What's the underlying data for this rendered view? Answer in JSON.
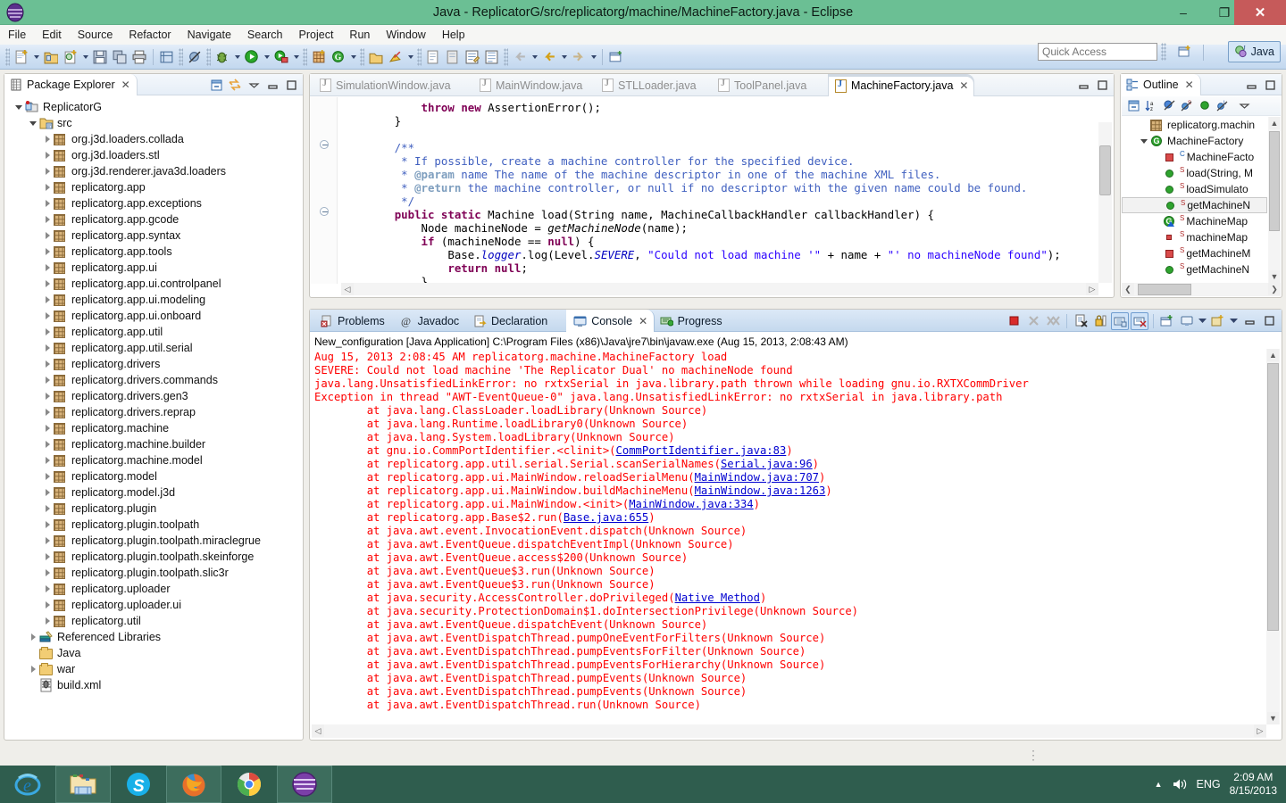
{
  "window": {
    "title": "Java - ReplicatorG/src/replicatorg/machine/MachineFactory.java - Eclipse",
    "minimize_label": "–",
    "maximize_label": "❐",
    "close_label": "✕"
  },
  "menubar": {
    "items": [
      "File",
      "Edit",
      "Source",
      "Refactor",
      "Navigate",
      "Search",
      "Project",
      "Run",
      "Window",
      "Help"
    ]
  },
  "toolbar": {
    "quick_access_placeholder": "Quick Access",
    "perspective_label": "Java",
    "icons": [
      "new-wizard-icon",
      "new-wizard-dropdown",
      "new-java-project-icon",
      "new-class-icon",
      "new-class-dropdown",
      "save-icon",
      "save-all-icon",
      "print-icon",
      "toggle-ruler-icon",
      "skip-breakpoints-icon",
      "debug-icon",
      "debug-dropdown",
      "run-icon",
      "run-dropdown",
      "run-external-tools-icon",
      "external-tools-dropdown",
      "new-java-package-icon",
      "new-annotation-icon",
      "new-annotation-dropdown",
      "open-type-icon",
      "search-icon",
      "search-dropdown",
      "next-annotation-icon",
      "previous-annotation-icon",
      "last-edit-icon",
      "toggle-mark-icon",
      "back-icon",
      "back-dropdown",
      "forward-icon",
      "forward-dropdown",
      "pin-editor-icon",
      "new-perspective-icon"
    ]
  },
  "package_explorer": {
    "title": "Package Explorer",
    "close_label": "✕",
    "tools": [
      "collapse-all-icon",
      "link-with-editor-icon",
      "view-menu-icon",
      "minimize-icon",
      "maximize-icon"
    ],
    "tree": [
      {
        "label": "ReplicatorG",
        "indent": 0,
        "arrow": "open",
        "icon": "java-project-icon"
      },
      {
        "label": "src",
        "indent": 1,
        "arrow": "open",
        "icon": "source-folder-icon"
      },
      {
        "label": "org.j3d.loaders.collada",
        "indent": 2,
        "arrow": "closed",
        "icon": "package-icon"
      },
      {
        "label": "org.j3d.loaders.stl",
        "indent": 2,
        "arrow": "closed",
        "icon": "package-icon"
      },
      {
        "label": "org.j3d.renderer.java3d.loaders",
        "indent": 2,
        "arrow": "closed",
        "icon": "package-icon"
      },
      {
        "label": "replicatorg.app",
        "indent": 2,
        "arrow": "closed",
        "icon": "package-icon"
      },
      {
        "label": "replicatorg.app.exceptions",
        "indent": 2,
        "arrow": "closed",
        "icon": "package-icon"
      },
      {
        "label": "replicatorg.app.gcode",
        "indent": 2,
        "arrow": "closed",
        "icon": "package-icon"
      },
      {
        "label": "replicatorg.app.syntax",
        "indent": 2,
        "arrow": "closed",
        "icon": "package-icon"
      },
      {
        "label": "replicatorg.app.tools",
        "indent": 2,
        "arrow": "closed",
        "icon": "package-icon"
      },
      {
        "label": "replicatorg.app.ui",
        "indent": 2,
        "arrow": "closed",
        "icon": "package-icon"
      },
      {
        "label": "replicatorg.app.ui.controlpanel",
        "indent": 2,
        "arrow": "closed",
        "icon": "package-icon"
      },
      {
        "label": "replicatorg.app.ui.modeling",
        "indent": 2,
        "arrow": "closed",
        "icon": "package-icon"
      },
      {
        "label": "replicatorg.app.ui.onboard",
        "indent": 2,
        "arrow": "closed",
        "icon": "package-icon"
      },
      {
        "label": "replicatorg.app.util",
        "indent": 2,
        "arrow": "closed",
        "icon": "package-icon"
      },
      {
        "label": "replicatorg.app.util.serial",
        "indent": 2,
        "arrow": "closed",
        "icon": "package-icon"
      },
      {
        "label": "replicatorg.drivers",
        "indent": 2,
        "arrow": "closed",
        "icon": "package-icon"
      },
      {
        "label": "replicatorg.drivers.commands",
        "indent": 2,
        "arrow": "closed",
        "icon": "package-icon"
      },
      {
        "label": "replicatorg.drivers.gen3",
        "indent": 2,
        "arrow": "closed",
        "icon": "package-icon"
      },
      {
        "label": "replicatorg.drivers.reprap",
        "indent": 2,
        "arrow": "closed",
        "icon": "package-icon"
      },
      {
        "label": "replicatorg.machine",
        "indent": 2,
        "arrow": "closed",
        "icon": "package-icon"
      },
      {
        "label": "replicatorg.machine.builder",
        "indent": 2,
        "arrow": "closed",
        "icon": "package-icon"
      },
      {
        "label": "replicatorg.machine.model",
        "indent": 2,
        "arrow": "closed",
        "icon": "package-icon"
      },
      {
        "label": "replicatorg.model",
        "indent": 2,
        "arrow": "closed",
        "icon": "package-icon"
      },
      {
        "label": "replicatorg.model.j3d",
        "indent": 2,
        "arrow": "closed",
        "icon": "package-icon"
      },
      {
        "label": "replicatorg.plugin",
        "indent": 2,
        "arrow": "closed",
        "icon": "package-icon"
      },
      {
        "label": "replicatorg.plugin.toolpath",
        "indent": 2,
        "arrow": "closed",
        "icon": "package-icon"
      },
      {
        "label": "replicatorg.plugin.toolpath.miraclegrue",
        "indent": 2,
        "arrow": "closed",
        "icon": "package-icon"
      },
      {
        "label": "replicatorg.plugin.toolpath.skeinforge",
        "indent": 2,
        "arrow": "closed",
        "icon": "package-icon"
      },
      {
        "label": "replicatorg.plugin.toolpath.slic3r",
        "indent": 2,
        "arrow": "closed",
        "icon": "package-icon"
      },
      {
        "label": "replicatorg.uploader",
        "indent": 2,
        "arrow": "closed",
        "icon": "package-icon"
      },
      {
        "label": "replicatorg.uploader.ui",
        "indent": 2,
        "arrow": "closed",
        "icon": "package-icon"
      },
      {
        "label": "replicatorg.util",
        "indent": 2,
        "arrow": "closed",
        "icon": "package-icon"
      },
      {
        "label": "Referenced Libraries",
        "indent": 1,
        "arrow": "closed",
        "icon": "library-icon"
      },
      {
        "label": "Java",
        "indent": 1,
        "arrow": "none",
        "icon": "folder-icon"
      },
      {
        "label": "war",
        "indent": 1,
        "arrow": "closed",
        "icon": "folder-icon"
      },
      {
        "label": "build.xml",
        "indent": 1,
        "arrow": "none",
        "icon": "ant-file-icon"
      }
    ]
  },
  "editor": {
    "tabs": [
      {
        "label": "SimulationWindow.java",
        "active": false,
        "closable": false
      },
      {
        "label": "MainWindow.java",
        "active": false,
        "closable": false
      },
      {
        "label": "STLLoader.java",
        "active": false,
        "closable": false
      },
      {
        "label": "ToolPanel.java",
        "active": false,
        "closable": false
      },
      {
        "label": "MachineFactory.java",
        "active": true,
        "closable": true
      }
    ],
    "close_label": "✕",
    "minimize_label": "❐",
    "maximize_label": "☐",
    "code_lines": [
      "            throw new AssertionError();",
      "        }",
      "",
      "        /**",
      "         * If possible, create a machine controller for the specified device.",
      "         * @param name The name of the machine descriptor in one of the machine XML files.",
      "         * @return the machine controller, or null if no descriptor with the given name could be found.",
      "         */",
      "        public static Machine load(String name, MachineCallbackHandler callbackHandler) {",
      "            Node machineNode = getMachineNode(name);",
      "            if (machineNode == null) {",
      "                Base.logger.log(Level.SEVERE, \"Could not load machine '\" + name + \"' no machineNode found\");",
      "                return null;",
      "            }"
    ]
  },
  "outline": {
    "title": "Outline",
    "close_label": "✕",
    "tools": [
      "collapse-all-icon",
      "sort-icon",
      "hide-fields-icon",
      "hide-static-icon",
      "hide-nonpublic-icon",
      "hide-local-types-icon",
      "view-menu-icon"
    ],
    "minimize_label": "❐",
    "maximize_label": "☐",
    "items": [
      {
        "label": "replicatorg.machin",
        "indent": 1,
        "arrow": "none",
        "icon": "package-icon",
        "modifier": "",
        "selected": false
      },
      {
        "label": "MachineFactory",
        "indent": 1,
        "arrow": "open",
        "icon": "class-icon",
        "modifier": "",
        "selected": false
      },
      {
        "label": "MachineFacto",
        "indent": 2,
        "arrow": "none",
        "icon": "field-private-icon",
        "modifier": "C",
        "selected": false
      },
      {
        "label": "load(String, M",
        "indent": 2,
        "arrow": "none",
        "icon": "method-public-icon",
        "modifier": "S",
        "selected": false
      },
      {
        "label": "loadSimulato",
        "indent": 2,
        "arrow": "none",
        "icon": "method-public-icon",
        "modifier": "S",
        "selected": false
      },
      {
        "label": "getMachineN",
        "indent": 2,
        "arrow": "none",
        "icon": "method-public-icon",
        "modifier": "S",
        "selected": true
      },
      {
        "label": "MachineMap",
        "indent": 2,
        "arrow": "none",
        "icon": "inner-class-icon",
        "modifier": "S",
        "selected": false
      },
      {
        "label": "machineMap",
        "indent": 2,
        "arrow": "none",
        "icon": "field-small-icon",
        "modifier": "S",
        "selected": false
      },
      {
        "label": "getMachineM",
        "indent": 2,
        "arrow": "none",
        "icon": "field-private-icon",
        "modifier": "S",
        "selected": false
      },
      {
        "label": "getMachineN",
        "indent": 2,
        "arrow": "none",
        "icon": "method-public-icon",
        "modifier": "S",
        "selected": false
      }
    ],
    "scroll_left": "❮",
    "scroll_right": "❯"
  },
  "console": {
    "tabs": [
      {
        "label": "Problems",
        "icon": "problems-icon",
        "active": false,
        "closable": false
      },
      {
        "label": "Javadoc",
        "icon": "javadoc-icon",
        "active": false,
        "closable": false
      },
      {
        "label": "Declaration",
        "icon": "declaration-icon",
        "active": false,
        "closable": false
      },
      {
        "label": "Console",
        "icon": "console-icon",
        "active": true,
        "closable": true
      },
      {
        "label": "Progress",
        "icon": "progress-icon",
        "active": false,
        "closable": false
      }
    ],
    "close_label": "✕",
    "tools": [
      "terminate-icon",
      "remove-launch-icon",
      "remove-all-terminated-icon",
      "clear-console-icon",
      "scroll-lock-icon",
      "pin-console-icon",
      "show-console-on-output-icon",
      "open-console-icon",
      "display-selected-console-icon",
      "display-console-dropdown",
      "new-console-view-icon",
      "new-console-dropdown",
      "minimize-icon",
      "maximize-icon"
    ],
    "header": "New_configuration [Java Application] C:\\Program Files (x86)\\Java\\jre7\\bin\\javaw.exe (Aug 15, 2013, 2:08:43 AM)",
    "lines": [
      {
        "text": "Aug 15, 2013 2:08:45 AM replicatorg.machine.MachineFactory load",
        "indent": 0,
        "links": []
      },
      {
        "text": "SEVERE: Could not load machine 'The Replicator Dual' no machineNode found",
        "indent": 0,
        "links": []
      },
      {
        "text": "java.lang.UnsatisfiedLinkError: no rxtxSerial in java.library.path thrown while loading gnu.io.RXTXCommDriver",
        "indent": 0,
        "links": []
      },
      {
        "text": "Exception in thread \"AWT-EventQueue-0\" java.lang.UnsatisfiedLinkError: no rxtxSerial in java.library.path",
        "indent": 0,
        "links": []
      },
      {
        "text": "        at java.lang.ClassLoader.loadLibrary(Unknown Source)",
        "indent": 1,
        "links": []
      },
      {
        "text": "        at java.lang.Runtime.loadLibrary0(Unknown Source)",
        "indent": 1,
        "links": []
      },
      {
        "text": "        at java.lang.System.loadLibrary(Unknown Source)",
        "indent": 1,
        "links": []
      },
      {
        "text": "        at gnu.io.CommPortIdentifier.<clinit>(",
        "indent": 1,
        "links": [
          "CommPortIdentifier.java:83"
        ],
        "tail": ")"
      },
      {
        "text": "        at replicatorg.app.util.serial.Serial.scanSerialNames(",
        "indent": 1,
        "links": [
          "Serial.java:96"
        ],
        "tail": ")"
      },
      {
        "text": "        at replicatorg.app.ui.MainWindow.reloadSerialMenu(",
        "indent": 1,
        "links": [
          "MainWindow.java:707"
        ],
        "tail": ")"
      },
      {
        "text": "        at replicatorg.app.ui.MainWindow.buildMachineMenu(",
        "indent": 1,
        "links": [
          "MainWindow.java:1263"
        ],
        "tail": ")"
      },
      {
        "text": "        at replicatorg.app.ui.MainWindow.<init>(",
        "indent": 1,
        "links": [
          "MainWindow.java:334"
        ],
        "tail": ")"
      },
      {
        "text": "        at replicatorg.app.Base$2.run(",
        "indent": 1,
        "links": [
          "Base.java:655"
        ],
        "tail": ")"
      },
      {
        "text": "        at java.awt.event.InvocationEvent.dispatch(Unknown Source)",
        "indent": 1,
        "links": []
      },
      {
        "text": "        at java.awt.EventQueue.dispatchEventImpl(Unknown Source)",
        "indent": 1,
        "links": []
      },
      {
        "text": "        at java.awt.EventQueue.access$200(Unknown Source)",
        "indent": 1,
        "links": []
      },
      {
        "text": "        at java.awt.EventQueue$3.run(Unknown Source)",
        "indent": 1,
        "links": []
      },
      {
        "text": "        at java.awt.EventQueue$3.run(Unknown Source)",
        "indent": 1,
        "links": []
      },
      {
        "text": "        at java.security.AccessController.doPrivileged(",
        "indent": 1,
        "links": [
          "Native Method"
        ],
        "tail": ")"
      },
      {
        "text": "        at java.security.ProtectionDomain$1.doIntersectionPrivilege(Unknown Source)",
        "indent": 1,
        "links": []
      },
      {
        "text": "        at java.awt.EventQueue.dispatchEvent(Unknown Source)",
        "indent": 1,
        "links": []
      },
      {
        "text": "        at java.awt.EventDispatchThread.pumpOneEventForFilters(Unknown Source)",
        "indent": 1,
        "links": []
      },
      {
        "text": "        at java.awt.EventDispatchThread.pumpEventsForFilter(Unknown Source)",
        "indent": 1,
        "links": []
      },
      {
        "text": "        at java.awt.EventDispatchThread.pumpEventsForHierarchy(Unknown Source)",
        "indent": 1,
        "links": []
      },
      {
        "text": "        at java.awt.EventDispatchThread.pumpEvents(Unknown Source)",
        "indent": 1,
        "links": []
      },
      {
        "text": "        at java.awt.EventDispatchThread.pumpEvents(Unknown Source)",
        "indent": 1,
        "links": []
      },
      {
        "text": "        at java.awt.EventDispatchThread.run(Unknown Source)",
        "indent": 1,
        "links": []
      }
    ]
  },
  "statusbar": {
    "dots": "⋮"
  },
  "taskbar": {
    "buttons": [
      {
        "name": "internet-explorer-icon",
        "open": false
      },
      {
        "name": "file-explorer-icon",
        "open": true
      },
      {
        "name": "skype-icon",
        "open": false
      },
      {
        "name": "firefox-icon",
        "open": true
      },
      {
        "name": "chrome-icon",
        "open": false
      },
      {
        "name": "eclipse-icon",
        "open": true
      }
    ],
    "tray": {
      "show_hidden_label": "▲",
      "volume_label": "volume-icon",
      "language": "ENG",
      "time": "2:09 AM",
      "date": "8/15/2013"
    }
  },
  "colors": {
    "title_bar": "#6bbf94",
    "close_button": "#c65a5a",
    "toolbar": "#cfe0f3",
    "taskbar": "#2f5d4e",
    "error_text": "#ff0000",
    "keyword": "#7f0055",
    "string": "#2a00ff",
    "comment": "#3f5fbf",
    "link": "#0000d0"
  }
}
